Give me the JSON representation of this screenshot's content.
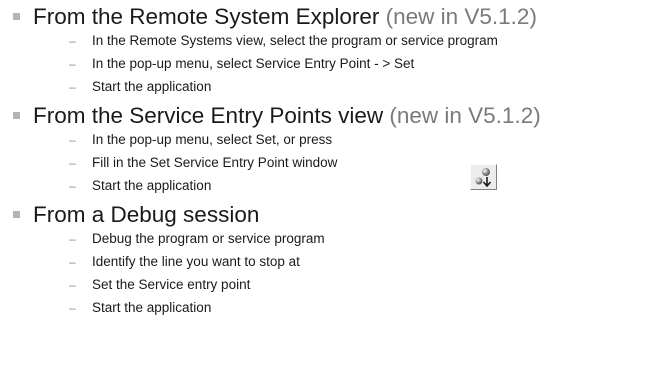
{
  "sections": [
    {
      "title": "From the Remote System Explorer",
      "note": " (new in V5.1.2)",
      "items": [
        "In the Remote Systems view, select the program or service program",
        "In the pop-up menu, select Service Entry Point - > Set",
        "Start the application"
      ]
    },
    {
      "title": "From the Service Entry Points view",
      "note": " (new in V5.1.2)",
      "items": [
        "In the pop-up menu, select Set, or press",
        "Fill in the Set Service Entry Point window",
        "Start the application"
      ]
    },
    {
      "title": "From a Debug session",
      "note": "",
      "items": [
        "Debug the program or service program",
        "Identify the line you want to stop at",
        "Set the Service entry point",
        "Start the application"
      ]
    }
  ],
  "dash_glyph": "–",
  "icon": {
    "name": "set-service-entry-point-icon"
  }
}
